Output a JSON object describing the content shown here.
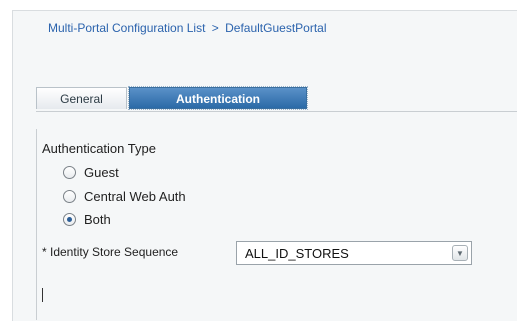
{
  "breadcrumb": {
    "parent": "Multi-Portal Configuration List",
    "separator": ">",
    "current": "DefaultGuestPortal"
  },
  "tabs": [
    {
      "label": "General",
      "active": false
    },
    {
      "label": "Authentication",
      "active": true
    }
  ],
  "authentication": {
    "type_label": "Authentication Type",
    "options": [
      {
        "label": "Guest",
        "checked": false
      },
      {
        "label": "Central Web Auth",
        "checked": false
      },
      {
        "label": "Both",
        "checked": true
      }
    ],
    "identity_store_label": "* Identity Store Sequence",
    "identity_store_value": "ALL_ID_STORES",
    "dropdown_icon": "chevron-down-icon"
  },
  "colors": {
    "link": "#2b63ad",
    "active_tab": "#2b6aa7"
  }
}
